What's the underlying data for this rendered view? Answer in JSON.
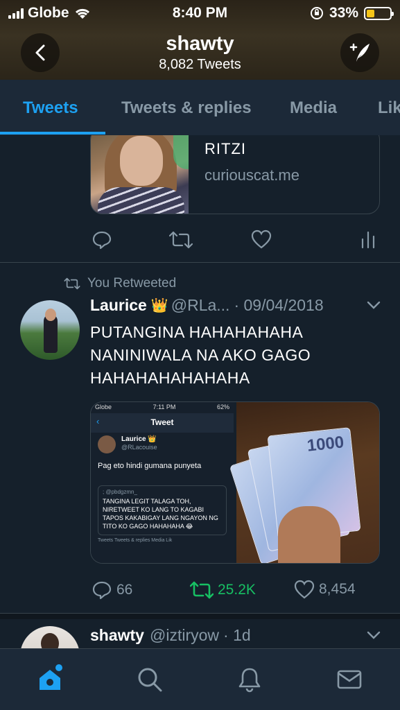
{
  "status_bar": {
    "carrier": "Globe",
    "time": "8:40 PM",
    "battery": "33%",
    "battery_level": 0.33
  },
  "header": {
    "title": "shawty",
    "subtitle": "8,082 Tweets"
  },
  "tabs": [
    {
      "label": "Tweets",
      "active": true
    },
    {
      "label": "Tweets & replies",
      "active": false
    },
    {
      "label": "Media",
      "active": false
    },
    {
      "label": "Lik",
      "active": false
    }
  ],
  "tweet1": {
    "card": {
      "title": "RITZI",
      "domain": "curiouscat.me"
    }
  },
  "tweet2": {
    "retweet_label": "You Retweeted",
    "name": "Laurice",
    "crown": "👑",
    "handle": "@RLa...",
    "date": "· 09/04/2018",
    "text": "PUTANGINA HAHAHAHAHA NANINIWALA NA AKO GAGO HAHAHAHAHAHAHA",
    "media_screenshot": {
      "carrier": "Globe",
      "time": "7:11 PM",
      "battery": "62%",
      "header": "Tweet",
      "name": "Laurice 👑",
      "handle": "@RLacouise",
      "text": "Pag eto hindi gumana punyeta",
      "quote_handle": "; @pbdgzmn_",
      "quote_text": "TANGINA LEGIT TALAGA TOH, NIRETWEET KO LANG TO KAGABI TAPOS KAKABIGAY LANG NGAYON NG TITO KO GAGO HAHAHAHA 😂",
      "tabs": "Tweets   Tweets & replies   Media   Lik"
    },
    "media_photo": {
      "bill_value": "1000"
    },
    "replies": "66",
    "retweets": "25.2K",
    "likes": "8,454"
  },
  "tweet3": {
    "name": "shawty",
    "handle": "@iztiryow",
    "date": "· 1d"
  },
  "colors": {
    "background": "#15202b",
    "accent": "#1da1f2",
    "retweet_green": "#17bf63",
    "muted": "#8899a6"
  },
  "bottom_nav": [
    "home-icon",
    "search-icon",
    "bell-icon",
    "mail-icon"
  ]
}
